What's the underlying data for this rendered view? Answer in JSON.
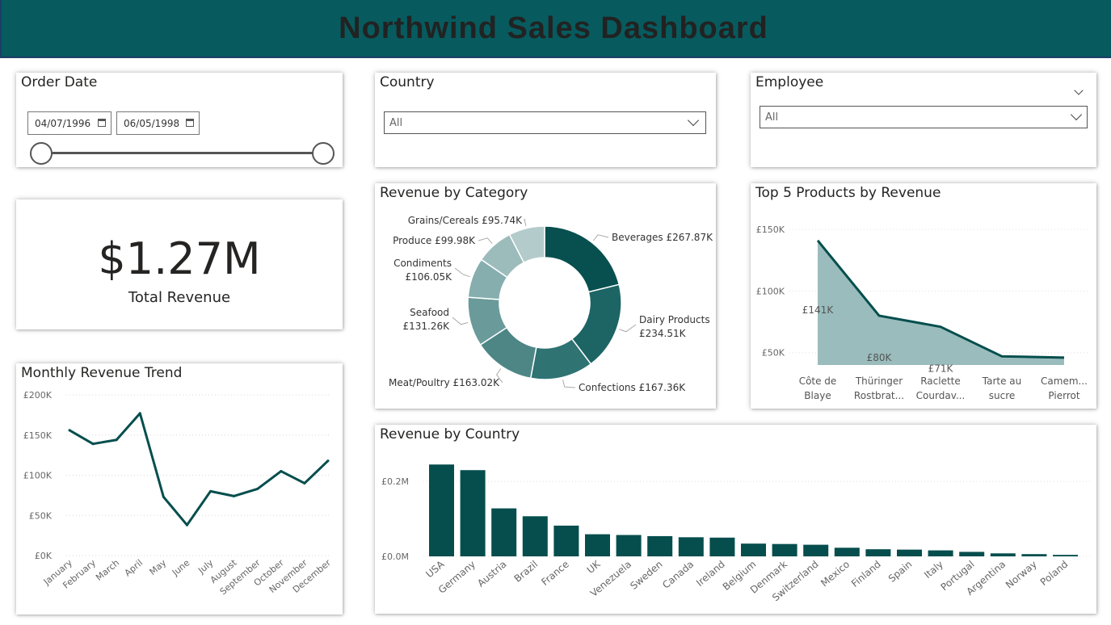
{
  "header": {
    "title": "Northwind Sales Dashboard"
  },
  "colors": {
    "header_bg": "#075b5e",
    "primary": "#054e4d",
    "area_fill": "#9abcbc"
  },
  "order_date": {
    "title": "Order Date",
    "start": "04/07/1996",
    "end": "06/05/1998",
    "start_icon": "calendar-icon",
    "end_icon": "calendar-icon"
  },
  "country_filter": {
    "title": "Country",
    "value": "All"
  },
  "employee_filter": {
    "title": "Employee",
    "value": "All"
  },
  "kpi": {
    "value": "$1.27M",
    "label": "Total Revenue"
  },
  "monthly_trend": {
    "title": "Monthly Revenue Trend",
    "chart_data": {
      "type": "line",
      "categories": [
        "January",
        "February",
        "March",
        "April",
        "May",
        "June",
        "July",
        "August",
        "September",
        "October",
        "November",
        "December"
      ],
      "values": [
        156000,
        139000,
        144000,
        177000,
        73000,
        38000,
        80000,
        74000,
        83000,
        105000,
        90000,
        118000
      ],
      "ylim": [
        0,
        200000
      ],
      "yticks": [
        "£0K",
        "£50K",
        "£100K",
        "£150K",
        "£200K"
      ],
      "grid": true
    }
  },
  "category_chart": {
    "title": "Revenue by Category",
    "chart_data": {
      "type": "pie",
      "donut": true,
      "slices": [
        {
          "name": "Beverages",
          "value": 267.87,
          "label": "Beverages £267.87K",
          "color": "#07504f"
        },
        {
          "name": "Dairy Products",
          "value": 234.51,
          "label_lines": [
            "Dairy Products",
            "£234.51K"
          ],
          "color": "#1c6564"
        },
        {
          "name": "Confections",
          "value": 167.36,
          "label": "Confections £167.36K",
          "color": "#2f7373"
        },
        {
          "name": "Meat/Poultry",
          "value": 163.02,
          "label": "Meat/Poultry £163.02K",
          "color": "#4e8686"
        },
        {
          "name": "Seafood",
          "value": 131.26,
          "label_lines": [
            "Seafood",
            "£131.26K"
          ],
          "color": "#6a9a9a"
        },
        {
          "name": "Condiments",
          "value": 106.05,
          "label_lines": [
            "Condiments",
            "£106.05K"
          ],
          "color": "#86aeae"
        },
        {
          "name": "Produce",
          "value": 99.98,
          "label": "Produce £99.98K",
          "color": "#9cbcbc"
        },
        {
          "name": "Grains/Cereals",
          "value": 95.74,
          "label": "Grains/Cereals £95.74K",
          "color": "#b3cbcb"
        }
      ]
    }
  },
  "top_products": {
    "title": "Top 5 Products by Revenue",
    "chart_data": {
      "type": "area",
      "categories": [
        {
          "lines": [
            "Côte de",
            "Blaye"
          ]
        },
        {
          "lines": [
            "Thüringer",
            "Rostbrat..."
          ]
        },
        {
          "lines": [
            "Raclette",
            "Courdav..."
          ]
        },
        {
          "lines": [
            "Tarte au",
            "sucre"
          ]
        },
        {
          "lines": [
            "Camem...",
            "Pierrot"
          ]
        }
      ],
      "values": [
        141000,
        80000,
        71000,
        47000,
        46000
      ],
      "data_labels": [
        "£141K",
        "£80K",
        "£71K",
        "",
        ""
      ],
      "ylim": [
        40000,
        152000
      ],
      "yticks": [
        {
          "v": 50000,
          "label": "£50K"
        },
        {
          "v": 100000,
          "label": "£100K"
        },
        {
          "v": 150000,
          "label": "£150K"
        }
      ]
    }
  },
  "country_chart": {
    "title": "Revenue by Country",
    "chart_data": {
      "type": "bar",
      "categories": [
        "USA",
        "Germany",
        "Austria",
        "Brazil",
        "France",
        "UK",
        "Venezuela",
        "Sweden",
        "Canada",
        "Ireland",
        "Belgium",
        "Denmark",
        "Switzerland",
        "Mexico",
        "Finland",
        "Spain",
        "Italy",
        "Portugal",
        "Argentina",
        "Norway",
        "Poland"
      ],
      "values": [
        0.245,
        0.23,
        0.128,
        0.107,
        0.082,
        0.059,
        0.057,
        0.054,
        0.051,
        0.05,
        0.034,
        0.033,
        0.031,
        0.023,
        0.019,
        0.018,
        0.016,
        0.012,
        0.008,
        0.006,
        0.004
      ],
      "unit": "£M",
      "ylim": [
        0,
        0.28
      ],
      "yticks": [
        {
          "v": 0,
          "label": "£0.0M"
        },
        {
          "v": 0.2,
          "label": "£0.2M"
        }
      ]
    }
  }
}
